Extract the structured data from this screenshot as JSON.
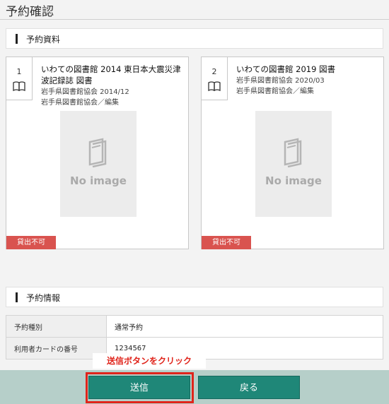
{
  "page_title": "予約確認",
  "sections": {
    "materials": "予約資料",
    "info": "予約情報"
  },
  "items": [
    {
      "number": "1",
      "title": "いわての図書館 2014 東日本大震災津波記録誌 図書",
      "publisher_date": "岩手県図書館協会 2014/12",
      "editor": "岩手県図書館協会／編集",
      "image_text": "No image",
      "status": "貸出不可"
    },
    {
      "number": "2",
      "title": "いわての図書館 2019 図書",
      "publisher_date": "岩手県図書館協会 2020/03",
      "editor": "岩手県図書館協会／編集",
      "image_text": "No image",
      "status": "貸出不可"
    }
  ],
  "reservation_info": {
    "rows": [
      {
        "label": "予約種別",
        "value": "通常予約"
      },
      {
        "label": "利用者カードの番号",
        "value": "1234567"
      }
    ]
  },
  "buttons": {
    "send": "送信",
    "back": "戻る"
  },
  "annotation": {
    "callout": "送信ボタンをクリック",
    "color": "#e0241b"
  },
  "colors": {
    "button": "#1f8778",
    "footer": "#b6cfc9",
    "badge": "#d9534f"
  }
}
